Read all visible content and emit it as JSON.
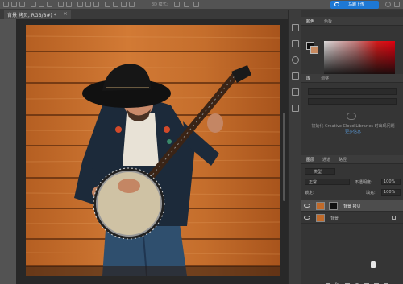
{
  "option_bar": {
    "mode_label": "3D 模式:",
    "cloud_button_label": "马跑上传"
  },
  "document": {
    "tab_title": "背景 拷贝, RGB/8#) *",
    "close_glyph": "×"
  },
  "panels": {
    "color_tabs": [
      "颜色",
      "色板"
    ],
    "library_tabs": [
      "库",
      "调整"
    ],
    "library_message": "初始化 Creative Cloud Libraries 时出现问题",
    "library_link": "更多信息",
    "layer_tabs": [
      "图层",
      "通道",
      "路径"
    ],
    "kind_filter": "类型",
    "blend_mode": "正常",
    "opacity_label": "不透明度:",
    "opacity_value": "100%",
    "lock_label": "锁定:",
    "fill_label": "填充:",
    "fill_value": "100%",
    "layers": [
      {
        "name": "背景 拷贝",
        "selected": true,
        "has_mask": true
      },
      {
        "name": "背景",
        "selected": false,
        "has_mask": false
      }
    ],
    "footer_icons": [
      "link-icon",
      "fx-icon",
      "mask-icon",
      "adjustment-icon",
      "group-icon",
      "new-layer-icon",
      "trash-icon"
    ],
    "footer_fx": "fx"
  },
  "colors": {
    "accent": "#1e78d4",
    "foreground": "#111111",
    "background": "#c88a60"
  }
}
